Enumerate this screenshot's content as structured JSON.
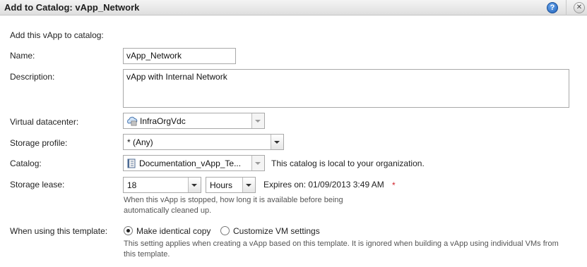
{
  "dialog": {
    "title": "Add to Catalog: vApp_Network",
    "help_glyph": "?",
    "close_glyph": "✕"
  },
  "form": {
    "intro": "Add this vApp to catalog:",
    "name": {
      "label": "Name:",
      "value": "vApp_Network"
    },
    "description": {
      "label": "Description:",
      "value": "vApp with Internal Network"
    },
    "virtual_datacenter": {
      "label": "Virtual datacenter:",
      "value": "InfraOrgVdc",
      "icon": "cloud-datacenter-icon"
    },
    "storage_profile": {
      "label": "Storage profile:",
      "value": "* (Any)"
    },
    "catalog": {
      "label": "Catalog:",
      "value": "Documentation_vApp_Te...",
      "icon": "catalog-icon",
      "note": "This catalog is local to your organization."
    },
    "storage_lease": {
      "label": "Storage lease:",
      "value": "18",
      "unit": "Hours",
      "expires": "Expires on: 01/09/2013 3:49 AM",
      "required_mark": "*",
      "hint_line1": "When this vApp is stopped, how long it is available before being",
      "hint_line2": "automatically cleaned up."
    },
    "template_mode": {
      "label": "When using this template:",
      "options": [
        {
          "label": "Make identical copy",
          "selected": true
        },
        {
          "label": "Customize VM settings",
          "selected": false
        }
      ],
      "hint_line1": "This setting applies when creating a vApp based on this template. It is ignored when building a vApp using individual VMs from",
      "hint_line2": "this template."
    }
  },
  "colors": {
    "required": "#d0222a",
    "help_blue": "#1d5fb8"
  }
}
